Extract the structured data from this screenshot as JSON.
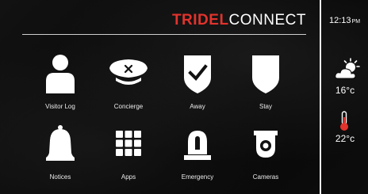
{
  "header": {
    "brand": "TRIDEL",
    "brand_suffix": "CONNECT"
  },
  "status": {
    "time": "12:13",
    "ampm": "PM",
    "weather_icon": "partly-cloudy-icon",
    "outdoor_temp": "16°c",
    "thermometer_icon": "thermometer-icon",
    "indoor_temp": "22°c"
  },
  "tiles": [
    {
      "label": "Visitor Log",
      "icon": "person-icon"
    },
    {
      "label": "Concierge",
      "icon": "concierge-hat-icon"
    },
    {
      "label": "Away",
      "icon": "shield-check-icon"
    },
    {
      "label": "Stay",
      "icon": "shield-icon"
    },
    {
      "label": "Notices",
      "icon": "bell-icon"
    },
    {
      "label": "Apps",
      "icon": "apps-grid-icon"
    },
    {
      "label": "Emergency",
      "icon": "siren-icon"
    },
    {
      "label": "Cameras",
      "icon": "camera-icon"
    }
  ],
  "colors": {
    "brand_red": "#e2332d",
    "text": "#ffffff",
    "thermometer": "#e2332d"
  }
}
